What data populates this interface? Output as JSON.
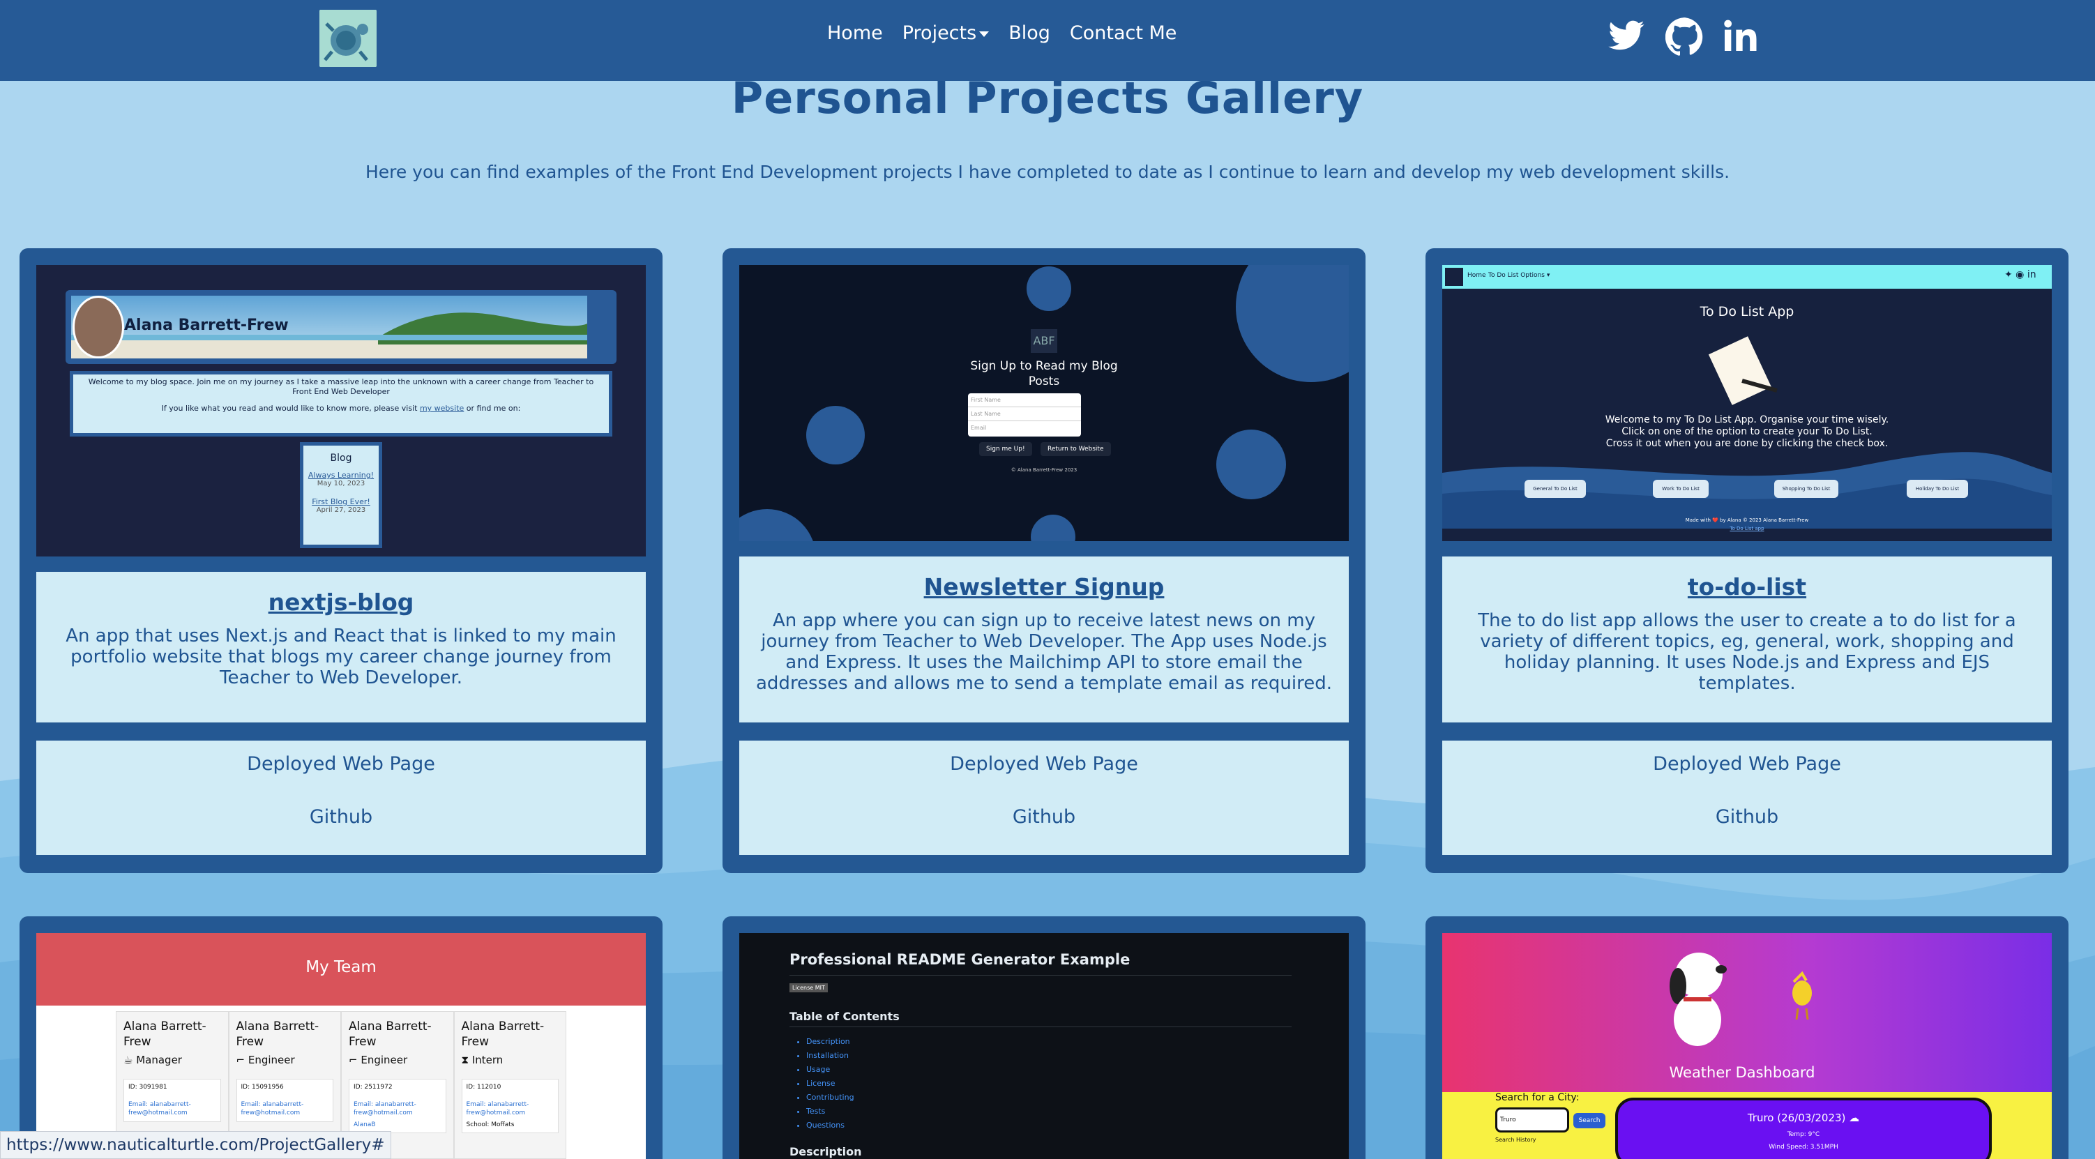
{
  "nav": {
    "links": [
      "Home",
      "Projects",
      "Blog",
      "Contact Me"
    ]
  },
  "header": {
    "title": "Personal Projects Gallery",
    "subtitle": "Here you can find examples of the Front End Development projects I have completed to date as I continue to learn and develop my web development skills."
  },
  "cards": [
    {
      "title": "nextjs-blog",
      "desc": "An app that uses Next.js and React that is linked to my main portfolio website that blogs my career change journey from Teacher to Web Developer.",
      "deployed": "Deployed Web Page",
      "github": "Github",
      "preview": {
        "name": "Alana Barrett-Frew",
        "welcome": "Welcome to my blog space. Join me on my journey as I take a massive leap into the unknown with a career change from Teacher to Front End Web Developer",
        "visit": "If you like what you read and would like to know more, please visit",
        "site": "my website",
        "findme": "or find me on:",
        "blog_heading": "Blog",
        "post1": "Always Learning!",
        "date1": "May 10, 2023",
        "post2": "First Blog Ever!",
        "date2": "April 27, 2023"
      }
    },
    {
      "title": "Newsletter Signup",
      "desc": "An app where you can sign up to receive latest news on my journey from Teacher to Web Developer. The App uses Node.js and Express. It uses the Mailchimp API to store email the addresses and allows me to send a template email as required.",
      "deployed": "Deployed Web Page",
      "github": "Github",
      "preview": {
        "logo": "ABF",
        "heading1": "Sign Up to Read my Blog",
        "heading2": "Posts",
        "first": "First Name",
        "last": "Last Name",
        "email": "Email",
        "btn1": "Sign me Up!",
        "btn2": "Return to Website",
        "copy": "© Alana Barrett-Frew 2023"
      }
    },
    {
      "title": "to-do-list",
      "desc": "The to do list app allows the user to create a to do list for a variety of different topics, eg, general, work, shopping and holiday planning. It uses Node.js and Express and EJS templates.",
      "deployed": "Deployed Web Page",
      "github": "Github",
      "preview": {
        "nav_home": "Home",
        "nav_options": "To Do List Options ▾",
        "heading": "To Do List App",
        "line1": "Welcome to my To Do List App. Organise your time wisely.",
        "line2": "Click on one of the option to create your To Do List.",
        "line3": "Cross it out when you are done by clicking the check box.",
        "btns": [
          "General To Do List",
          "Work To Do List",
          "Shopping To Do List",
          "Holiday To Do List"
        ],
        "footer1": "Made with ❤️ by Alana © 2023 Alana Barrett-Frew",
        "footer2": "To Do List app"
      }
    },
    {
      "preview": {
        "header": "My Team",
        "members": [
          {
            "name": "Alana Barrett-Frew",
            "role": "Manager",
            "id": "ID: 3091981",
            "email": "Email: alanabarrett-frew@hotmail.com"
          },
          {
            "name": "Alana Barrett-Frew",
            "role": "Engineer",
            "id": "ID: 15091956",
            "email": "Email: alanabarrett-frew@hotmail.com"
          },
          {
            "name": "Alana Barrett-Frew",
            "role": "Engineer",
            "id": "ID: 2511972",
            "email": "Email: alanabarrett-frew@hotmail.com"
          },
          {
            "name": "Alana Barrett-Frew",
            "role": "Intern",
            "id": "ID: 112010",
            "email": "Email: alanabarrett-frew@hotmail.com"
          }
        ],
        "github_partial": "AlanaB",
        "school": "School: Moffats"
      }
    },
    {
      "preview": {
        "title": "Professional README Generator Example",
        "license": "License MIT",
        "toc": "Table of Contents",
        "items": [
          "Description",
          "Installation",
          "Usage",
          "License",
          "Contributing",
          "Tests",
          "Questions"
        ],
        "desc": "Description"
      }
    },
    {
      "preview": {
        "title": "Weather Dashboard",
        "search_label": "Search for a City:",
        "search_value": "Truro",
        "search_btn": "Search",
        "history": "Search History",
        "city": "Truro (26/03/2023)",
        "temp": "Temp: 9°C",
        "wind": "Wind Speed: 3.51MPH"
      }
    }
  ],
  "status_bar": "https://www.nauticalturtle.com/ProjectGallery#",
  "colors": {
    "nav": "#265a96",
    "card": "#245893",
    "card_body": "#d1ecf6",
    "background": "#a9d4ef",
    "text": "#1f5491"
  }
}
